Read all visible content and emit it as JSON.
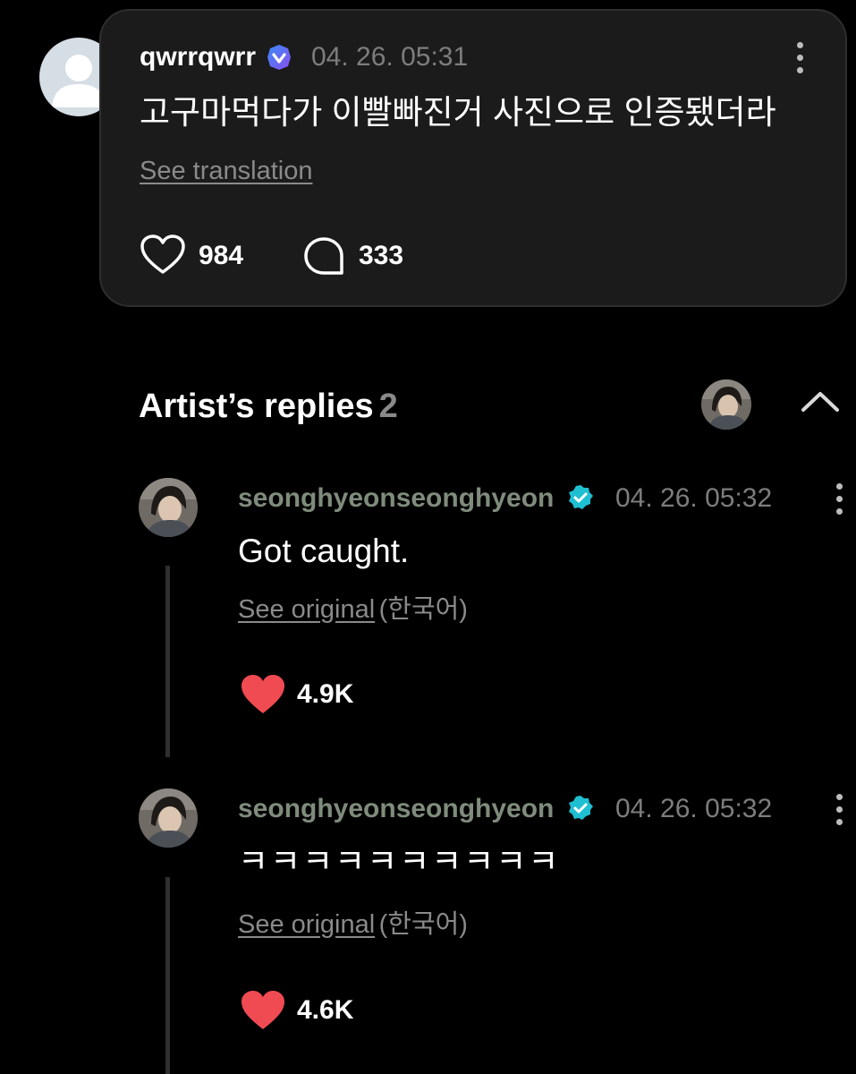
{
  "post": {
    "username": "qwrrqwrr",
    "timestamp": "04. 26. 05:31",
    "text": "고구마먹다가 이빨빠진거 사진으로 인증됐더라",
    "translate_link": "See translation",
    "likes": "984",
    "comments": "333",
    "badge_color": "#6a5cf6"
  },
  "artist_section": {
    "title": "Artist’s replies",
    "count": "2"
  },
  "replies": [
    {
      "username": "seonghyeonseonghyeon",
      "timestamp": "04. 26. 05:32",
      "text": "Got caught.",
      "original_link": "See original",
      "language": "(한국어)",
      "likes": "4.9K"
    },
    {
      "username": "seonghyeonseonghyeon",
      "timestamp": "04. 26. 05:32",
      "text": "ㅋㅋㅋㅋㅋㅋㅋㅋㅋㅋ",
      "original_link": "See original",
      "language": "(한국어)",
      "likes": "4.6K"
    }
  ],
  "colors": {
    "background": "#000000",
    "card": "#1b1b1b",
    "heart_liked": "#f04a52",
    "verified_artist": "#1fbfd2",
    "artist_name": "#7f8c7c"
  }
}
